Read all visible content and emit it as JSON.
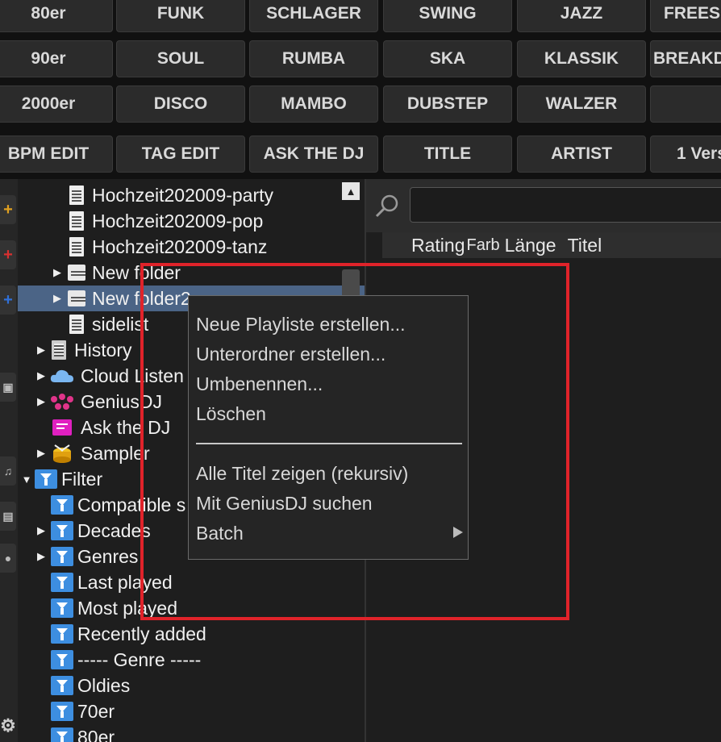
{
  "filter_buttons": [
    [
      "80er",
      "FUNK",
      "SCHLAGER",
      "SWING",
      "JAZZ",
      "FREES"
    ],
    [
      "90er",
      "SOUL",
      "RUMBA",
      "SKA",
      "KLASSIK",
      "BREAKD"
    ],
    [
      "2000er",
      "DISCO",
      "MAMBO",
      "DUBSTEP",
      "WALZER",
      ""
    ],
    [
      "BPM EDIT",
      "TAG EDIT",
      "ASK THE DJ",
      "TITLE",
      "ARTIST",
      "1 Vers"
    ]
  ],
  "tree": {
    "items": [
      {
        "label": "Hochzeit202009-party",
        "icon": "playlist-icon"
      },
      {
        "label": "Hochzeit202009-pop",
        "icon": "playlist-icon"
      },
      {
        "label": "Hochzeit202009-tanz",
        "icon": "playlist-icon"
      },
      {
        "label": "New folder",
        "icon": "folder-icon"
      },
      {
        "label": "New folder2",
        "icon": "folder-icon"
      },
      {
        "label": "sidelist",
        "icon": "playlist-icon"
      },
      {
        "label": "History",
        "icon": "history-icon"
      },
      {
        "label": "Cloud Listen",
        "icon": "cloud-icon"
      },
      {
        "label": "GeniusDJ",
        "icon": "geniusdj-icon"
      },
      {
        "label": "Ask the DJ",
        "icon": "chat-icon"
      },
      {
        "label": "Sampler",
        "icon": "drum-icon"
      },
      {
        "label": "Filter",
        "icon": "filter-folder-icon"
      },
      {
        "label": "Compatible s",
        "icon": "filter-icon"
      },
      {
        "label": "Decades",
        "icon": "filter-icon"
      },
      {
        "label": "Genres",
        "icon": "filter-icon"
      },
      {
        "label": "Last played",
        "icon": "filter-icon"
      },
      {
        "label": "Most played",
        "icon": "filter-icon"
      },
      {
        "label": "Recently added",
        "icon": "filter-icon"
      },
      {
        "label": "----- Genre -----",
        "icon": "filter-icon"
      },
      {
        "label": "Oldies",
        "icon": "filter-icon"
      },
      {
        "label": "70er",
        "icon": "filter-icon"
      },
      {
        "label": "80er",
        "icon": "filter-icon"
      }
    ]
  },
  "browser": {
    "columns": [
      "Rating",
      "Farb",
      "Länge",
      "Titel"
    ],
    "search_value": ""
  },
  "context_menu": {
    "items": [
      "Neue Playliste erstellen...",
      "Unterordner erstellen...",
      "Umbenennen...",
      "Löschen",
      "Alle Titel zeigen (rekursiv)",
      "Mit GeniusDJ suchen",
      "Batch"
    ]
  },
  "colors": {
    "selection": "#4b6486",
    "highlight_box": "#e0232a",
    "filter_icon": "#3d8ee0"
  }
}
